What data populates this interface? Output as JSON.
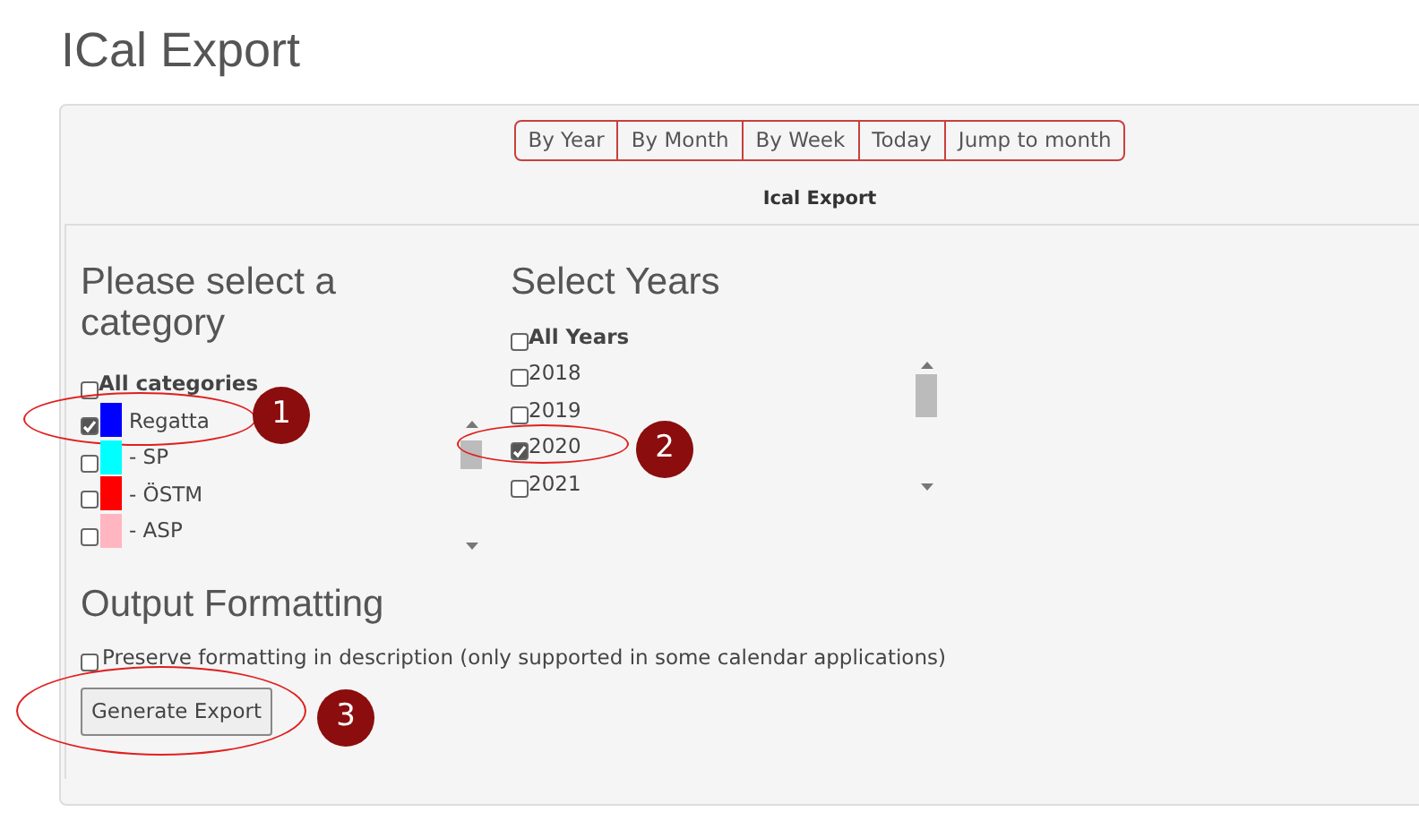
{
  "page_title": "ICal Export",
  "view_buttons": [
    {
      "label": "By Year"
    },
    {
      "label": "By Month"
    },
    {
      "label": "By Week"
    },
    {
      "label": "Today"
    },
    {
      "label": "Jump to month"
    }
  ],
  "panel_title": "Ical Export",
  "categories": {
    "heading": "Please select a category",
    "all": {
      "label": "All categories",
      "checked": false
    },
    "items": [
      {
        "label": "Regatta",
        "color": "#0000ff",
        "checked": true,
        "callout": "1"
      },
      {
        "label": "SP",
        "prefix": "- ",
        "color": "#00ffff",
        "checked": false
      },
      {
        "label": "ÖSTM",
        "prefix": "- ",
        "color": "#ff0000",
        "checked": false
      },
      {
        "label": "ASP",
        "prefix": "- ",
        "color": "#ffb6c1",
        "checked": false
      }
    ]
  },
  "years": {
    "heading": "Select Years",
    "all": {
      "label": "All Years",
      "checked": false
    },
    "items": [
      {
        "label": "2018",
        "checked": false
      },
      {
        "label": "2019",
        "checked": false
      },
      {
        "label": "2020",
        "checked": true,
        "callout": "2"
      },
      {
        "label": "2021",
        "checked": false
      }
    ]
  },
  "output": {
    "heading": "Output Formatting",
    "option": {
      "label": "Preserve formatting in description (only supported in some calendar applications)",
      "checked": false
    },
    "button": {
      "label": "Generate Export",
      "callout": "3"
    }
  }
}
